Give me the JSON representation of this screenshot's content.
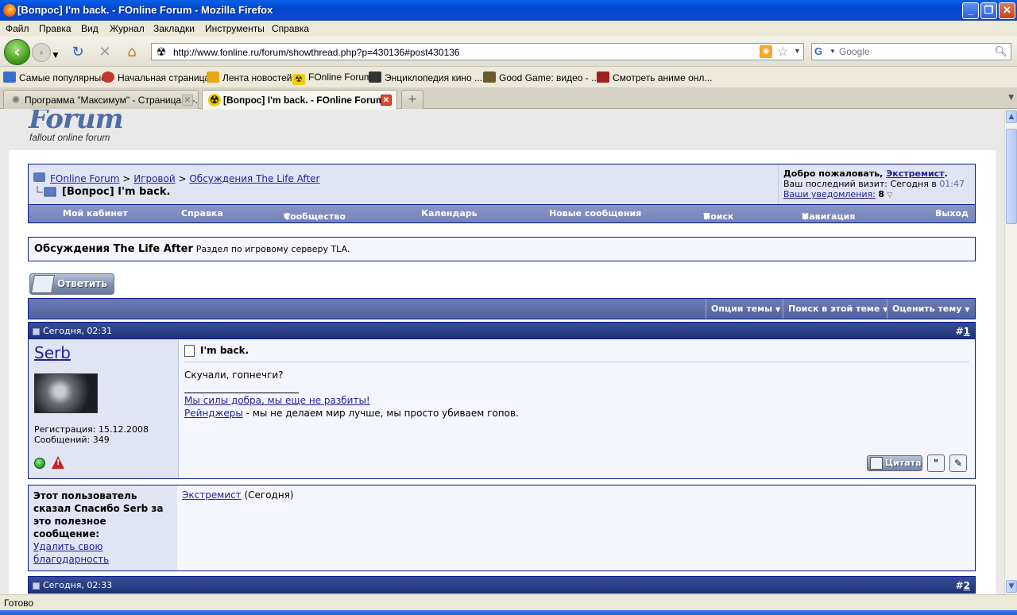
{
  "window": {
    "title": "[Вопрос] I'm back. - FOnline Forum - Mozilla Firefox"
  },
  "menu": [
    "Файл",
    "Правка",
    "Вид",
    "Журнал",
    "Закладки",
    "Инструменты",
    "Справка"
  ],
  "toolbar": {
    "url": "http://www.fonline.ru/forum/showthread.php?p=430136#post430136",
    "search_placeholder": "Google"
  },
  "bookmarks": [
    {
      "label": "Самые популярные",
      "icon": "popular-icon",
      "color": "#3b6ccf"
    },
    {
      "label": "Начальная страница",
      "icon": "firefox-start-icon",
      "color": "#c0392b"
    },
    {
      "label": "Лента новостей",
      "icon": "rss-feed-icon",
      "color": "#e6a817"
    },
    {
      "label": "FOnline Forum",
      "icon": "radiation-icon",
      "color": "#222222"
    },
    {
      "label": "Энциклопедия кино ...",
      "icon": "film-clapper-icon",
      "color": "#333333"
    },
    {
      "label": "Good Game: видео - ...",
      "icon": "goodgame-icon",
      "color": "#6b5a2a"
    },
    {
      "label": "Смотреть аниме онл...",
      "icon": "anime-icon",
      "color": "#a02020"
    }
  ],
  "tabs": [
    {
      "label": "Программа \"Максимум\" - Страница 4 -...",
      "active": false
    },
    {
      "label": "[Вопрос] I'm back. - FOnline Forum",
      "active": true
    }
  ],
  "forum": {
    "logo": "Forum",
    "logo_sub": "fallout online forum",
    "breadcrumb": [
      "FOnline Forum",
      "Игровой",
      "Обсуждения The Life After"
    ],
    "breadcrumb_sep": ">",
    "thread_title": "[Вопрос] I'm back.",
    "welcome_prefix": "Добро пожаловать,",
    "welcome_user": "Экстремист",
    "welcome_dot": ".",
    "last_visit_label": "Ваш последний визит: Сегодня в",
    "last_visit_time": "01:47",
    "notifications_label": "Ваши уведомления:",
    "notifications_count": "8",
    "nav_menu": [
      "Мой кабинет",
      "Справка",
      "Сообщество",
      "Календарь",
      "Новые сообщения",
      "Поиск",
      "Навигация",
      "Выход"
    ],
    "forum_name": "Обсуждения The Life After",
    "forum_description": "Раздел по игровому серверу TLA.",
    "reply_label": "Ответить",
    "thread_tools": [
      "Опции темы",
      "Поиск в этой теме",
      "Оценить тему"
    ]
  },
  "posts": [
    {
      "date": "Сегодня, 02:31",
      "number_prefix": "#",
      "number": "1",
      "username": "Serb",
      "registration": "Регистрация: 15.12.2008",
      "messages": "Сообщений: 349",
      "title": "I'm back.",
      "message": "Скучали, гопнечги?",
      "signature_link1": "Мы силы добра, мы еще не разбиты!",
      "signature_link2": "Рейнджеры",
      "signature_text2": " - мы не делаем мир лучше, мы просто убиваем гопов.",
      "quote_label": "Цитата"
    },
    {
      "date": "Сегодня, 02:33",
      "number_prefix": "#",
      "number": "2"
    }
  ],
  "thanks": {
    "label": "Этот пользователь сказал Спасибо Serb за это полезное сообщение:",
    "remove_label": "Удалить свою благодарность",
    "user": "Экстремист",
    "when": " (Сегодня)"
  },
  "statusbar": {
    "text": "Готово"
  }
}
